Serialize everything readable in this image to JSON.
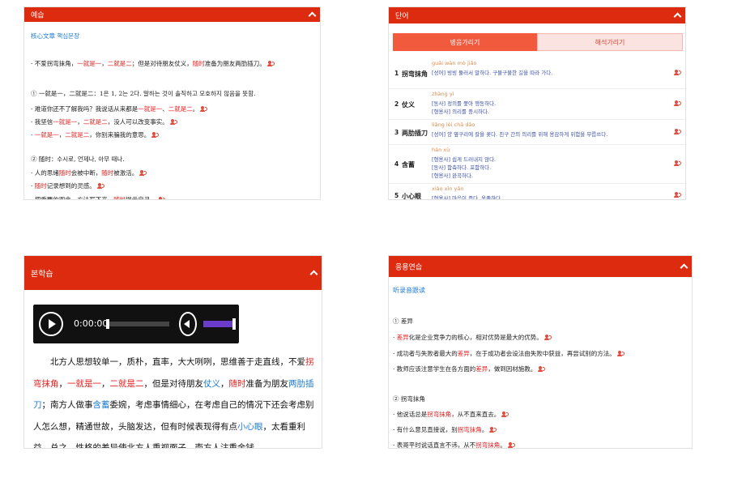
{
  "panel1": {
    "title": "예습",
    "subtitle": "核心文章 핵심문장",
    "lines": [
      [
        "· 不爱拐弯抹角，",
        "一就是一",
        "，",
        "二就是二",
        "；但是对待朋友仗义，",
        "随时",
        "准备为朋友两肋插刀。"
      ],
      "① 一就是一，二就是二：1은 1, 2는 2다. 말하는 것이 솔직하고 모호하지 않음을 뜻함.",
      [
        "· 难道你还不了解我吗？我说话从来都是",
        "一就是一",
        "、",
        "二就是二",
        "。"
      ],
      [
        "· 我坚信",
        "一就是一",
        "，",
        "二就是二",
        "，没人可以改变事实。"
      ],
      [
        "· ",
        "一就是一",
        "，",
        "二就是二",
        "，你别来骗我的意思。"
      ],
      "② 随时：수시로, 언제나, 아무 때나.",
      [
        "· 人的思绪",
        "随时",
        "会被中断，",
        "随时",
        "被激活。"
      ],
      [
        "· ",
        "随时",
        "记录想到的灵感。"
      ],
      [
        "· 把重要的观念、方法写下来，",
        "随时",
        "提示自己。"
      ]
    ]
  },
  "panel2": {
    "title": "단어",
    "tabs": [
      "병음가리기",
      "해석가리기"
    ],
    "rows": [
      {
        "num": "1",
        "word": "拐弯抹角",
        "pinyin": "guǎi wān mò jiǎo",
        "defs": [
          "[성어] 빙빙 둘러서 말하다. 구불구불한 길을 따라 가다."
        ]
      },
      {
        "num": "2",
        "word": "仗义",
        "pinyin": "zhàng yì",
        "defs": [
          "[동사] 정의를 쫓아 행동하다.",
          "[형용사] 의리를 중시하다."
        ]
      },
      {
        "num": "3",
        "word": "两肋插刀",
        "pinyin": "liǎng lèi chā dāo",
        "defs": [
          "[성어] 양 옆구리에 칼을 꽂다. 친구 간의 의리를 위해 용감하게 위험을 무릅쓰다."
        ]
      },
      {
        "num": "4",
        "word": "含蓄",
        "pinyin": "hán xù",
        "defs": [
          "[형용사] 쉽게 드러내지 않다.",
          "[동사] 함축하다. 포함하다.",
          "[형용사] 완곡하다."
        ]
      },
      {
        "num": "5",
        "word": "小心眼",
        "pinyin": "xiǎo xīn yǎn",
        "defs": [
          "[형용사] 마음이 좁다. 옹졸하다."
        ]
      }
    ]
  },
  "panel3": {
    "title": "본학습",
    "player": {
      "time": "0:00:00"
    },
    "paragraph": [
      [
        "北方人思想较单一，质朴，直率，大大咧咧，思维善于走直线，不爱",
        "n"
      ],
      [
        "拐弯抹角",
        "r"
      ],
      [
        "，",
        "n"
      ],
      [
        "一就是一",
        "r"
      ],
      [
        "，",
        "n"
      ],
      [
        "二就是二",
        "r"
      ],
      [
        "，但是对待朋友",
        "n"
      ],
      [
        "仗义",
        "b"
      ],
      [
        "，",
        "n"
      ],
      [
        "随时",
        "r"
      ],
      [
        "准备为朋友",
        "n"
      ],
      [
        "两肋插刀",
        "b"
      ],
      [
        "；南方人做事",
        "n"
      ],
      [
        "含蓄",
        "b"
      ],
      [
        "委婉，考虑事情细心，在考虑自己的情况下还会考虑别人怎么想，精通世故，头脑发达，但有时候表现得有点",
        "n"
      ],
      [
        "小心眼",
        "b"
      ],
      [
        "，太看重利益。总之，性格的差异使北方人重视面子，南方人注重金钱。",
        "n"
      ]
    ]
  },
  "panel4": {
    "title": "응용연습",
    "subtitle": "听录音跟读",
    "lines": [
      "① 差异",
      [
        "· ",
        "差异",
        "化是企业竞争力的核心，相对优势是最大的优势。"
      ],
      [
        "· 成功者与失败者最大的",
        "差异",
        "，在于成功者会设法由失败中获益，再尝试别的方法。"
      ],
      [
        "· 教师应该注意学生在各方面的",
        "差异",
        "，做到因材施教。"
      ],
      "② 拐弯抹角",
      [
        "· 他说话总是",
        "拐弯抹角",
        "，从不直来直去。"
      ],
      [
        "· 有什么意见直接说，别",
        "拐弯抹角",
        "。"
      ],
      [
        "· 表哥平时说话直言不讳，从不",
        "拐弯抹角",
        "。"
      ]
    ]
  }
}
